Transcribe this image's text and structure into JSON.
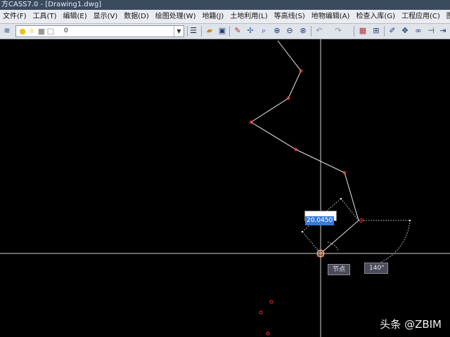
{
  "window": {
    "title": "方CASS7.0 - [Drawing1.dwg]"
  },
  "menu": [
    "文件(F)",
    "工具(T)",
    "编辑(E)",
    "显示(V)",
    "数据(D)",
    "绘图处理(W)",
    "地籍(J)",
    "土地利用(L)",
    "等高线(S)",
    "地物编辑(A)",
    "检查入库(G)",
    "工程应用(C)",
    "图幅管"
  ],
  "toolbar": {
    "layer_value": "0",
    "icons": [
      "layers-icon",
      "lightbulb-icon",
      "sun-icon",
      "lock-icon",
      "color-square-icon",
      "layer-manager-icon",
      "open-folder-icon",
      "save-icon",
      "pencil-icon",
      "snap-icon",
      "zoom-realtime-icon",
      "zoom-window-icon",
      "zoom-previous-icon",
      "zoom-extents-icon",
      "undo-icon",
      "redo-icon",
      "properties-icon",
      "grid-icon",
      "edit-icon",
      "move-icon",
      "link-icon",
      "trim-icon",
      "extend-icon"
    ]
  },
  "drawing": {
    "dimension_input": "20.0450",
    "snap_tooltip": "节点",
    "angle_tooltip": "140°"
  },
  "watermark": "头条 @ZBIM",
  "colors": {
    "canvas": "#000000",
    "polyline": "#ffffff",
    "point": "#ff2a2a",
    "crosshair": "#ffffff"
  }
}
